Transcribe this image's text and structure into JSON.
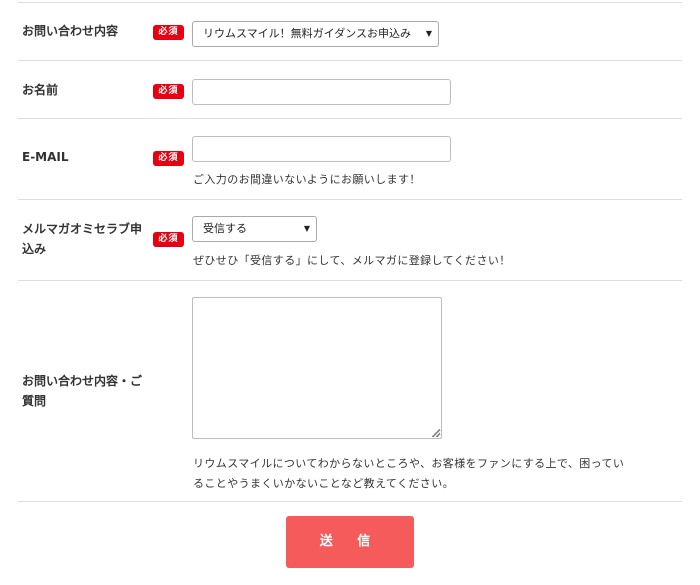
{
  "form": {
    "rows": {
      "inquiry_type": {
        "label": "お問い合わせ内容",
        "required_badge": "必須",
        "selected_value": "リウムスマイル！無料ガイダンスお申込み"
      },
      "name": {
        "label": "お名前",
        "required_badge": "必須",
        "value": "",
        "placeholder": ""
      },
      "email": {
        "label": "E-MAIL",
        "required_badge": "必須",
        "value": "",
        "placeholder": "",
        "note": "ご入力のお間違いないようにお願いします！"
      },
      "newsletter": {
        "label_line1": "メルマガオミセラブ申",
        "label_line2": "込み",
        "required_badge": "必須",
        "selected_value": "受信する",
        "note": "ぜひせひ「受信する」にして、メルマガに登録してください！"
      },
      "message": {
        "label_line1": "お問い合わせ内容・ご",
        "label_line2": "質問",
        "value": "",
        "note_line1": "リウムスマイルについてわからないところや、お客様をファンにする上で、困ってい",
        "note_line2": "ることやうまくいかないことなど教えてください。"
      }
    },
    "submit_label": "送 信"
  },
  "icons": {
    "dropdown_arrow": "▼"
  },
  "colors": {
    "required_badge": "#e60012",
    "submit_button": "#f55b5b",
    "divider": "#dedede"
  }
}
